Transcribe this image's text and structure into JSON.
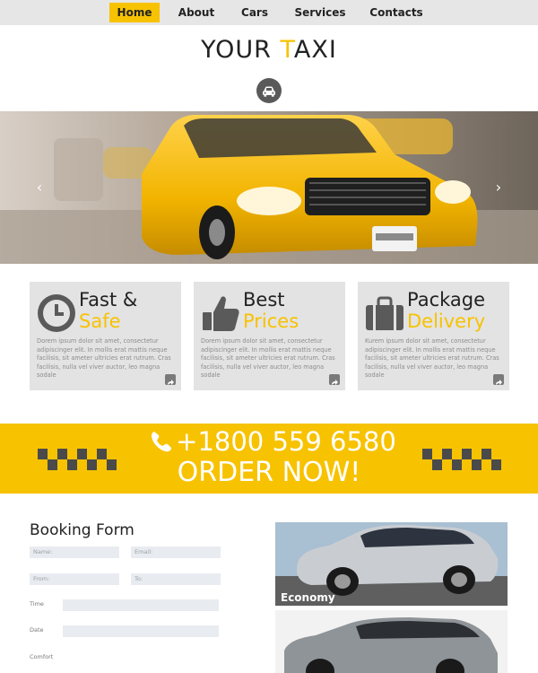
{
  "nav": {
    "items": [
      {
        "label": "Home",
        "active": true
      },
      {
        "label": "About",
        "active": false
      },
      {
        "label": "Cars",
        "active": false
      },
      {
        "label": "Services",
        "active": false
      },
      {
        "label": "Contacts",
        "active": false
      }
    ]
  },
  "header": {
    "logo_part1": "YOUR ",
    "logo_accent": "T",
    "logo_part2": "AXI",
    "icon": "taxi-icon"
  },
  "hero": {
    "prev_label": "‹",
    "next_label": "›"
  },
  "features": [
    {
      "title_line1": "Fast &",
      "title_line2": "Safe",
      "icon": "clock-icon",
      "text": "Dorem ipsum dolor sit amet, consectetur adipiscinger elit. In mollis erat mattis neque facilisis, sit ameter ultricies erat rutrum. Cras facilisis, nulla vel viver auctor, leo magna sodale"
    },
    {
      "title_line1": "Best",
      "title_line2": "Prices",
      "icon": "thumbs-up-icon",
      "text": "Dorem ipsum dolor sit amet, consectetur adipiscinger elit. In mollis erat mattis neque facilisis, sit ameter ultricies erat rutrum. Cras facilisis, nulla vel viver auctor, leo magna sodale"
    },
    {
      "title_line1": "Package",
      "title_line2": "Delivery",
      "icon": "briefcase-icon",
      "text": "Kurem ipsum dolor sit amet, consectetur adipiscinger elit. In mollis erat mattis neque facilisis, sit ameter ultricies erat rutrum. Cras facilisis, nulla vel viver auctor, leo magna sodale"
    }
  ],
  "cta": {
    "phone": "+1800 559 6580",
    "order": "ORDER NOW!"
  },
  "booking": {
    "title": "Booking Form",
    "name_placeholder": "Name:",
    "email_placeholder": "Email:",
    "from_placeholder": "From:",
    "to_placeholder": "To:",
    "time_label": "Time",
    "date_label": "Date",
    "comfort_label": "Comfort"
  },
  "cars": [
    {
      "label": "Economy"
    },
    {
      "label": ""
    }
  ],
  "colors": {
    "accent": "#f7c200",
    "nav_bg": "#e6e6e6",
    "feature_bg": "#e3e3e3",
    "icon_gray": "#5a5a5a"
  }
}
